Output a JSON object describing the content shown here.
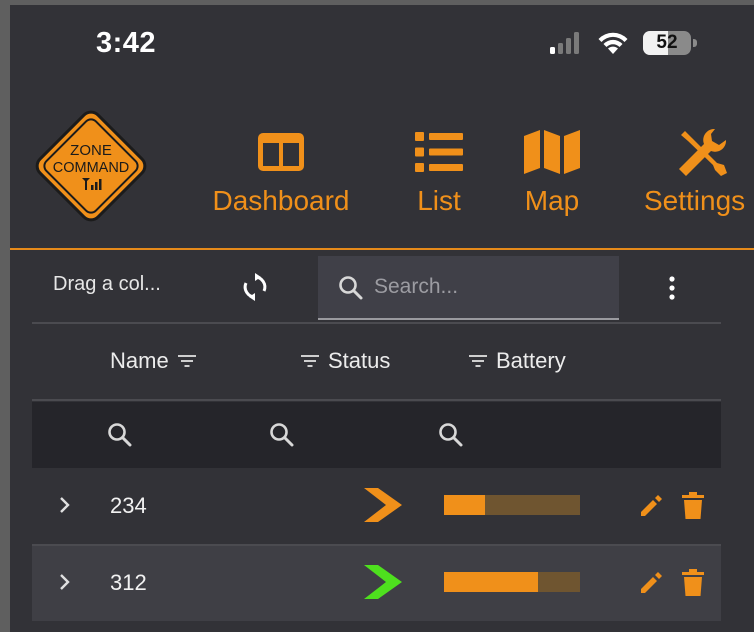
{
  "status_bar": {
    "time": "3:42",
    "battery_percent": "52",
    "battery_level": 0.52,
    "icons": [
      "cellular-signal-icon",
      "wifi-icon",
      "battery-icon"
    ]
  },
  "logo": {
    "line1": "ZONE",
    "line2": "COMMAND",
    "icon": "signal-bars-icon"
  },
  "nav": {
    "items": [
      {
        "label": "Dashboard",
        "icon": "dashboard-icon"
      },
      {
        "label": "List",
        "icon": "list-icon"
      },
      {
        "label": "Map",
        "icon": "map-icon"
      },
      {
        "label": "Settings",
        "icon": "tools-icon"
      }
    ]
  },
  "toolbar": {
    "group_hint": "Drag a col...",
    "search_placeholder": "Search...",
    "search_value": ""
  },
  "table": {
    "columns": [
      {
        "label": "Name",
        "icon": "filter-icon"
      },
      {
        "label": "Status",
        "icon": "filter-icon"
      },
      {
        "label": "Battery",
        "icon": "filter-icon"
      }
    ],
    "rows": [
      {
        "name": "234",
        "status": "chevron-right-arrow",
        "status_color": "#f0901a",
        "battery_level": 0.3
      },
      {
        "name": "312",
        "status": "chevron-right-arrow",
        "status_color": "#4ee01e",
        "battery_level": 0.69
      }
    ]
  },
  "colors": {
    "accent": "#f0901a",
    "background": "#323237",
    "status_ok": "#4ee01e"
  }
}
